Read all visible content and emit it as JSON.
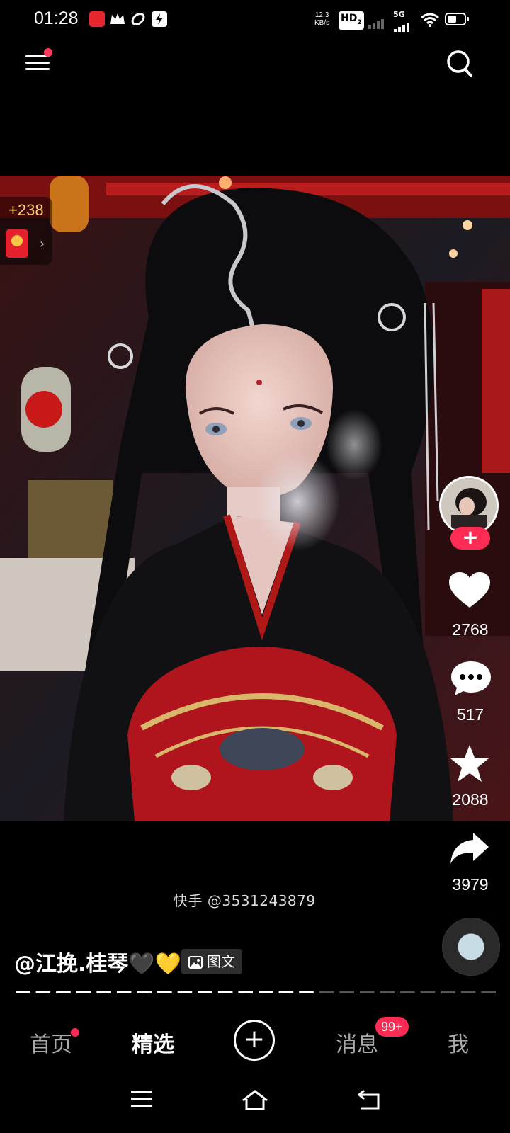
{
  "status_bar": {
    "time": "01:28",
    "net_speed_value": "12.3",
    "net_speed_unit": "KB/s",
    "hd": "HD",
    "sim": "2",
    "network": "5G",
    "notification_icons": [
      "video-app-icon",
      "crown-icon",
      "leaf-icon",
      "flash-icon"
    ]
  },
  "top_nav": {
    "menu_icon": "menu-icon",
    "search_icon": "search-icon",
    "menu_has_notification": true
  },
  "reward": {
    "count": "+238",
    "icon": "red-envelope-icon",
    "arrow": "›"
  },
  "side_actions": {
    "follow_label": "+",
    "likes": "2768",
    "comments": "517",
    "favorites": "2088",
    "shares": "3979"
  },
  "post": {
    "watermark": "快手 @3531243879",
    "author": "@江挽.桂琴🖤💛",
    "tag_label": "图文",
    "progress_segments_total": 24,
    "progress_segments_done": 15
  },
  "tabs": {
    "home": "首页",
    "featured": "精选",
    "create": "+",
    "messages": "消息",
    "messages_badge": "99+",
    "me": "我",
    "active": "featured"
  },
  "system_nav": [
    "menu-icon",
    "home-icon",
    "back-icon"
  ],
  "colors": {
    "accent": "#fe2c55",
    "background": "#000000",
    "reward_text": "#ffd479"
  }
}
